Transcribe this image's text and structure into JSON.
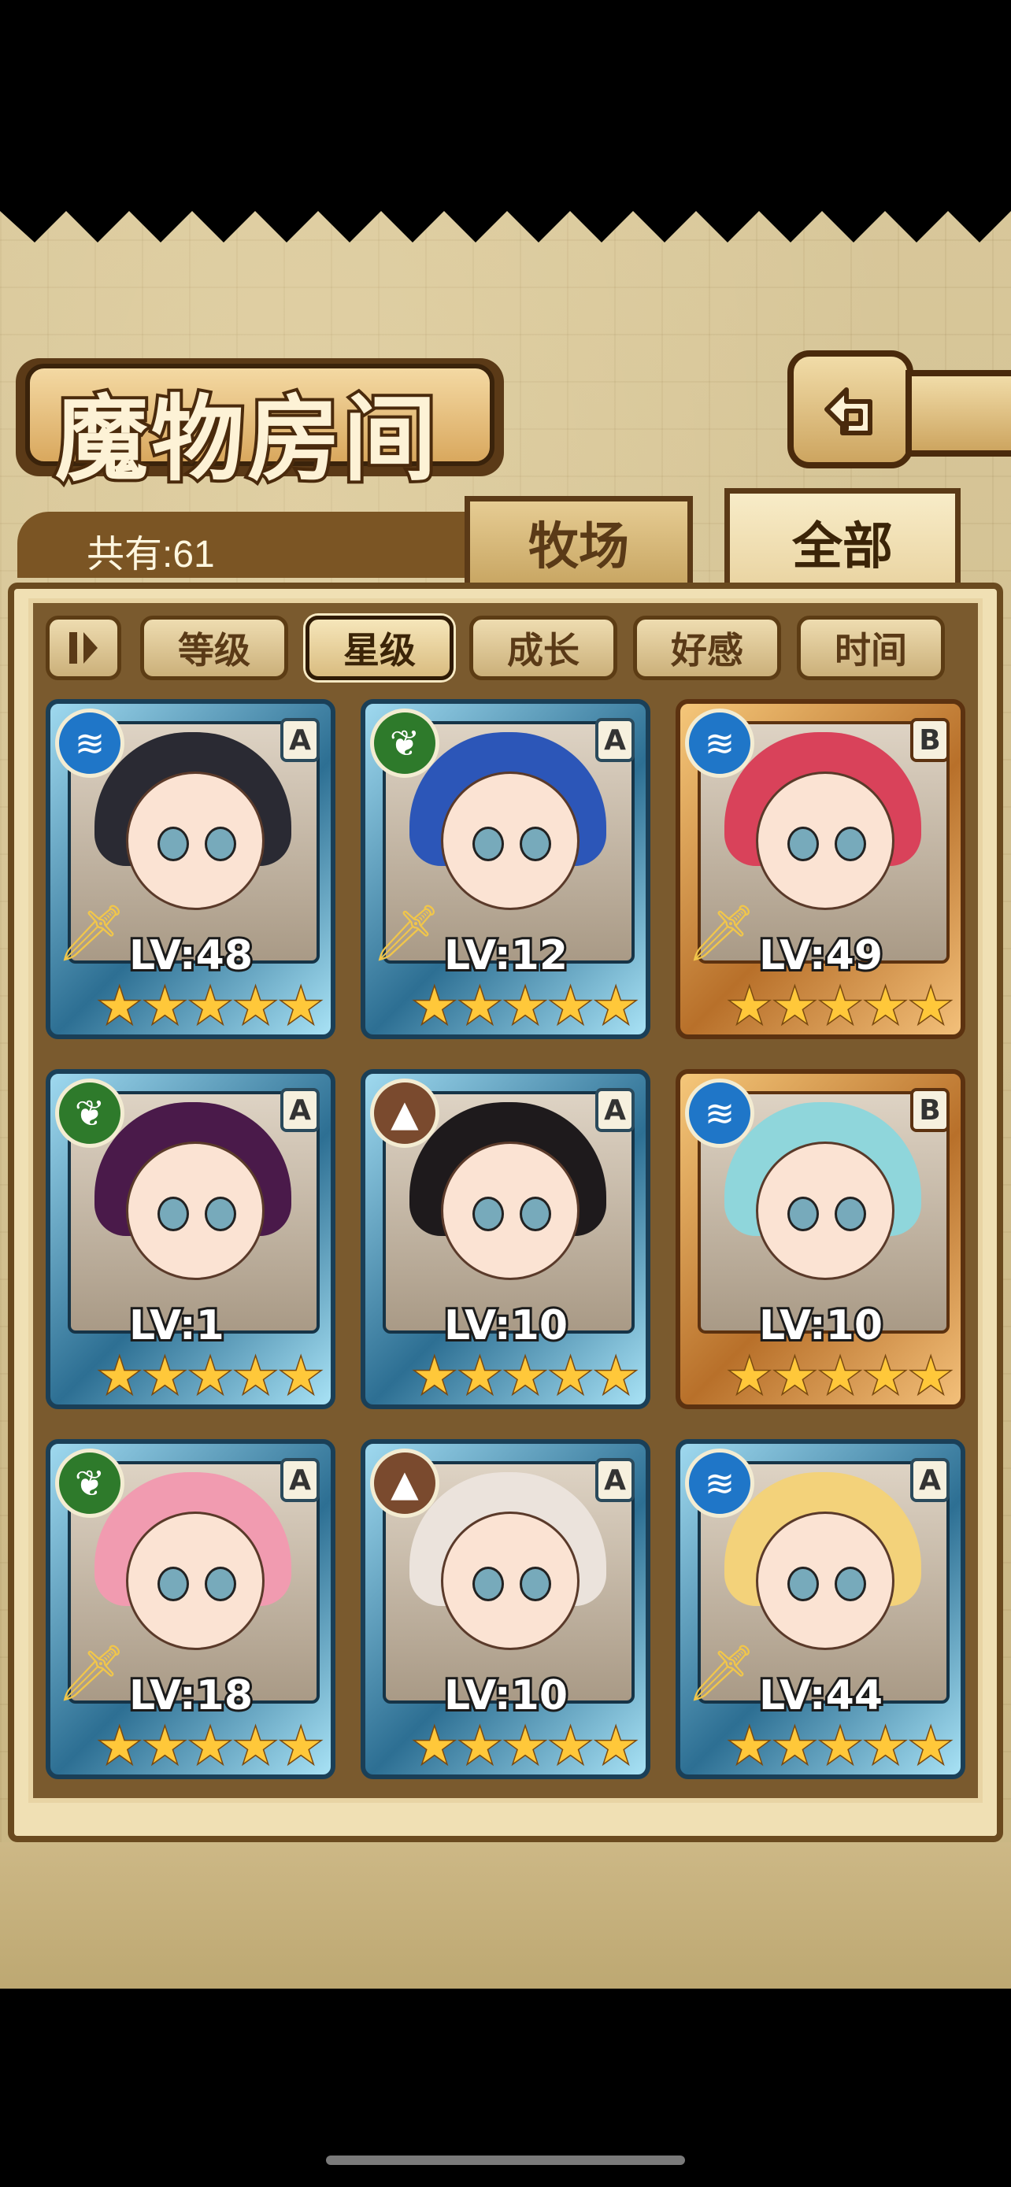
{
  "header": {
    "title": "魔物房间",
    "back_icon": "back-arrow-icon"
  },
  "summary": {
    "count_label": "共有:61"
  },
  "tabs": [
    {
      "label": "牧场",
      "active": false
    },
    {
      "label": "全部",
      "active": true
    }
  ],
  "filters": {
    "toggle_icon": "pause-icon",
    "items": [
      {
        "label": "等级",
        "active": false
      },
      {
        "label": "星级",
        "active": true
      },
      {
        "label": "成长",
        "active": false
      },
      {
        "label": "好感",
        "active": false
      },
      {
        "label": "时间",
        "active": false
      }
    ]
  },
  "cards": [
    {
      "element": "water",
      "rank": "A",
      "level": "LV:48",
      "stars": 5,
      "frame": "blue",
      "weapon": true,
      "hair": "#2a2a33"
    },
    {
      "element": "leaf",
      "rank": "A",
      "level": "LV:12",
      "stars": 5,
      "frame": "blue",
      "weapon": true,
      "hair": "#2c56b8"
    },
    {
      "element": "water",
      "rank": "B",
      "level": "LV:49",
      "stars": 5,
      "frame": "gold",
      "weapon": true,
      "hair": "#d9425a"
    },
    {
      "element": "leaf",
      "rank": "A",
      "level": "LV:1",
      "stars": 5,
      "frame": "blue",
      "weapon": false,
      "hair": "#4a1a4a"
    },
    {
      "element": "earth",
      "rank": "A",
      "level": "LV:10",
      "stars": 5,
      "frame": "blue",
      "weapon": false,
      "hair": "#1e1a1c"
    },
    {
      "element": "water",
      "rank": "B",
      "level": "LV:10",
      "stars": 5,
      "frame": "gold",
      "weapon": false,
      "hair": "#8fd6db"
    },
    {
      "element": "leaf",
      "rank": "A",
      "level": "LV:18",
      "stars": 5,
      "frame": "blue",
      "weapon": true,
      "hair": "#f19bb0"
    },
    {
      "element": "earth",
      "rank": "A",
      "level": "LV:10",
      "stars": 5,
      "frame": "blue",
      "weapon": false,
      "hair": "#ebe3dc"
    },
    {
      "element": "water",
      "rank": "A",
      "level": "LV:44",
      "stars": 5,
      "frame": "blue",
      "weapon": true,
      "hair": "#f3d27a"
    }
  ]
}
